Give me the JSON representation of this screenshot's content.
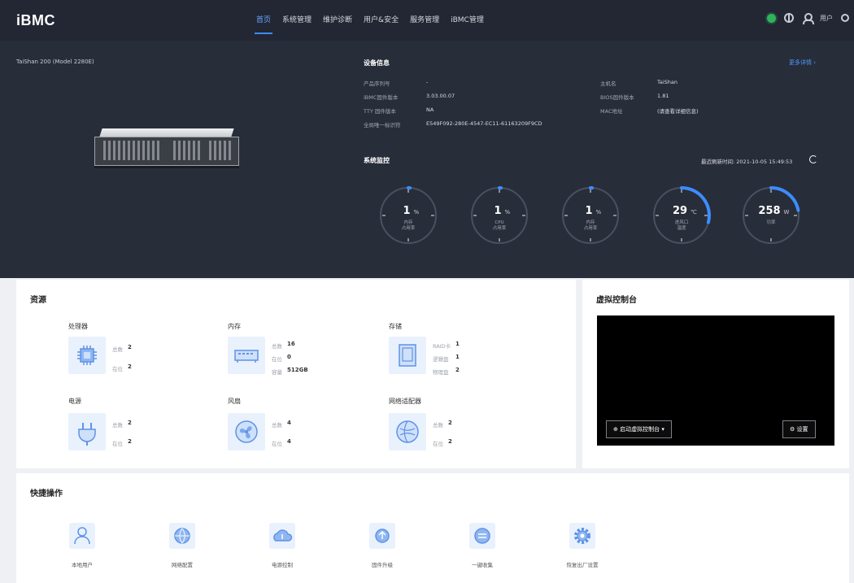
{
  "app": {
    "title": "iBMC"
  },
  "nav": {
    "items": [
      "首页",
      "系统管理",
      "维护诊断",
      "用户&安全",
      "服务管理",
      "iBMC管理"
    ],
    "active_index": 0
  },
  "header_right": {
    "user_name": "用户",
    "health_status": "正常",
    "icons": [
      "status-dot-icon",
      "globe-icon",
      "user-icon",
      "power-icon"
    ]
  },
  "server": {
    "model_name": "TaiShan 200 (Model 2280E)"
  },
  "device_info": {
    "title": "设备信息",
    "more_link": "更多详情 ›",
    "left": [
      {
        "key": "产品序列号",
        "value": "-"
      },
      {
        "key": "iBMC固件版本",
        "value": "3.03.00.07"
      },
      {
        "key": "TTY 固件版本",
        "value": "NA"
      },
      {
        "key": "全局唯一标识符",
        "value": "E549F092-280E-4547-EC11-61163209F9CD"
      }
    ],
    "right": [
      {
        "key": "主机名",
        "value": "TaiShan"
      },
      {
        "key": "BIOS固件版本",
        "value": "1.81"
      },
      {
        "key": "MAC地址",
        "value": "(请查看详细信息)"
      }
    ]
  },
  "monitor": {
    "title": "系统监控",
    "last_refresh_label": "最近刷新时间:",
    "last_refresh_time": "2021-10-05 15:49:53",
    "gauges": [
      {
        "value": "1",
        "unit": "%",
        "label_1": "内存",
        "label_2": "占用率",
        "fraction": 0.01
      },
      {
        "value": "1",
        "unit": "%",
        "label_1": "CPU",
        "label_2": "占用率",
        "fraction": 0.01
      },
      {
        "value": "1",
        "unit": "%",
        "label_1": "内存",
        "label_2": "占用率",
        "fraction": 0.01
      },
      {
        "value": "29",
        "unit": "℃",
        "label_1": "进风口",
        "label_2": "温度",
        "fraction": 0.29
      },
      {
        "value": "258",
        "unit": "W",
        "label_1": "功率",
        "label_2": "",
        "fraction": 0.22
      }
    ]
  },
  "resources": {
    "title": "资源",
    "items": [
      {
        "name": "处理器",
        "icon": "processor-icon",
        "stats": [
          {
            "k": "总数",
            "v": "2"
          },
          {
            "k": "在位",
            "v": "2"
          }
        ]
      },
      {
        "name": "内存",
        "icon": "memory-icon",
        "stats": [
          {
            "k": "总数",
            "v": "16"
          },
          {
            "k": "在位",
            "v": "0"
          },
          {
            "k": "容量",
            "v": "512GB"
          }
        ]
      },
      {
        "name": "存储",
        "icon": "storage-icon",
        "stats": [
          {
            "k": "RAID卡",
            "v": "1"
          },
          {
            "k": "逻辑盘",
            "v": "1"
          },
          {
            "k": "物理盘",
            "v": "2"
          }
        ]
      },
      {
        "name": "电源",
        "icon": "power-supply-icon",
        "stats": [
          {
            "k": "总数",
            "v": "2"
          },
          {
            "k": "在位",
            "v": "2"
          }
        ]
      },
      {
        "name": "风扇",
        "icon": "fan-icon",
        "stats": [
          {
            "k": "总数",
            "v": "4"
          },
          {
            "k": "在位",
            "v": "4"
          }
        ]
      },
      {
        "name": "网络适配器",
        "icon": "network-adapter-icon",
        "stats": [
          {
            "k": "总数",
            "v": "2"
          },
          {
            "k": "在位",
            "v": "2"
          }
        ]
      }
    ]
  },
  "console": {
    "title": "虚拟控制台",
    "launch_label": "启动虚拟控制台 ▾",
    "settings_label": "设置"
  },
  "quick_actions": {
    "title": "快捷操作",
    "items": [
      {
        "label": "本地用户",
        "icon": "user-icon"
      },
      {
        "label": "网络配置",
        "icon": "network-icon"
      },
      {
        "label": "电源控制",
        "icon": "cloud-power-icon"
      },
      {
        "label": "固件升级",
        "icon": "upgrade-icon"
      },
      {
        "label": "一键收集",
        "icon": "collect-icon"
      },
      {
        "label": "恢复出厂设置",
        "icon": "gear-icon"
      }
    ]
  },
  "colors": {
    "accent": "#3d8cff",
    "dark_bg": "#282d3a",
    "top_bg": "#222733",
    "status_ok": "#2fb35a"
  }
}
